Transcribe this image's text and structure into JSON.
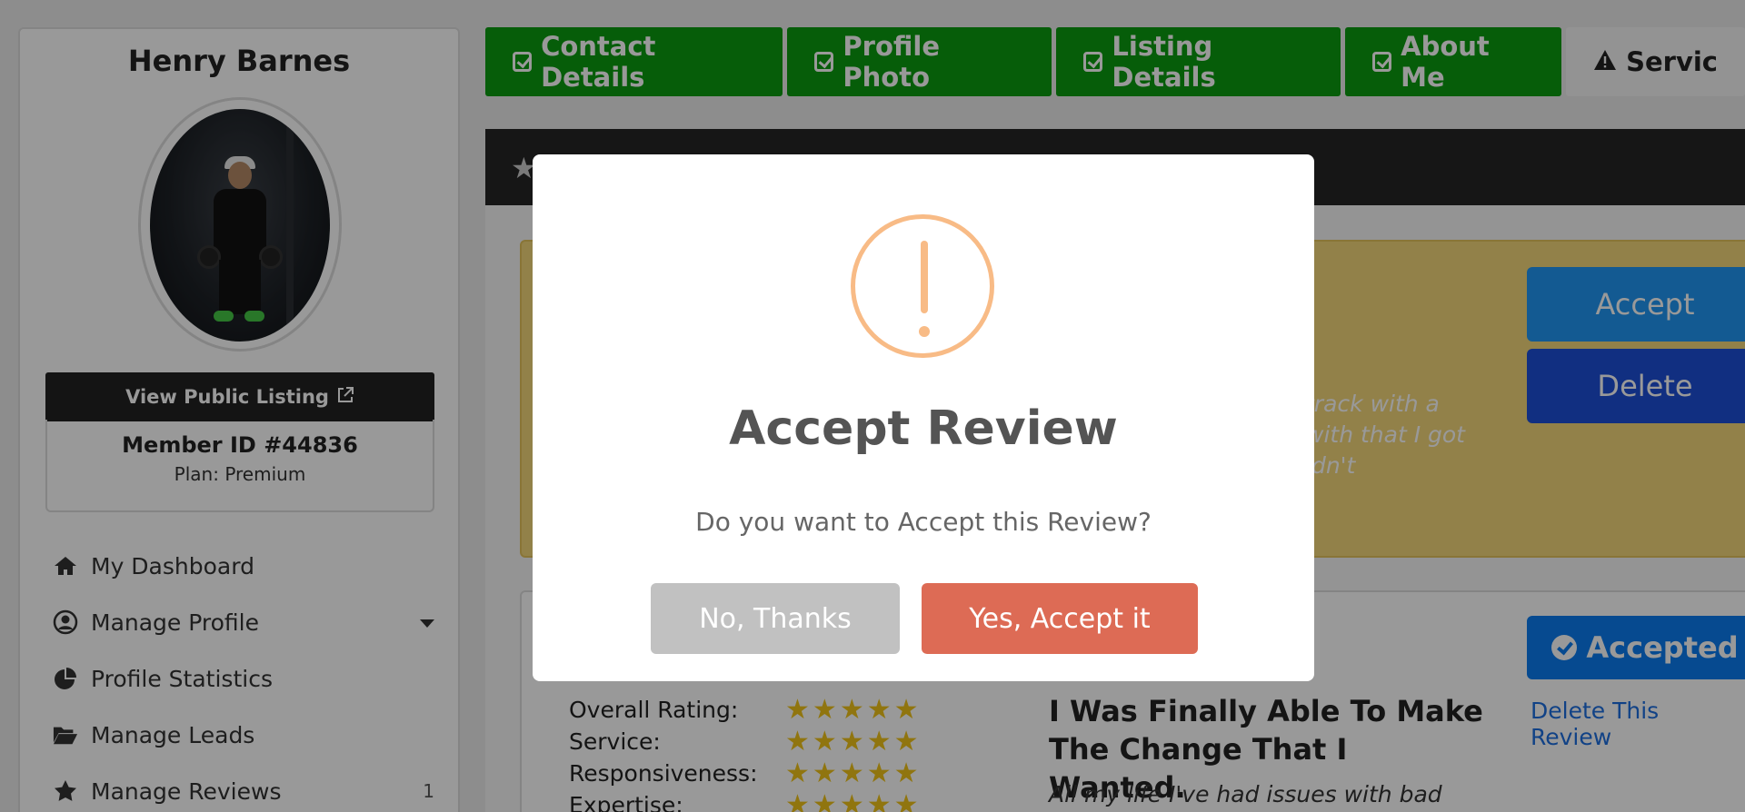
{
  "sidebar": {
    "user_name": "Henry Barnes",
    "view_public_listing": "View Public Listing",
    "member_id": "Member ID #44836",
    "plan": "Plan: Premium",
    "nav": [
      {
        "label": "My Dashboard",
        "icon": "home-icon"
      },
      {
        "label": "Manage Profile",
        "icon": "user-circle-icon"
      },
      {
        "label": "Profile Statistics",
        "icon": "pie-chart-icon"
      },
      {
        "label": "Manage Leads",
        "icon": "folder-open-icon"
      },
      {
        "label": "Manage Reviews",
        "icon": "star-icon",
        "count": "1"
      }
    ]
  },
  "tabs": [
    {
      "label": "Contact Details",
      "status": "complete"
    },
    {
      "label": "Profile Photo",
      "status": "complete"
    },
    {
      "label": "Listing Details",
      "status": "complete"
    },
    {
      "label": "About Me",
      "status": "complete"
    },
    {
      "label": "Servic",
      "status": "warning"
    }
  ],
  "pending_review": {
    "snippet": "track with a with that I got ldn't",
    "accept_label": "Accept",
    "delete_label": "Delete"
  },
  "accepted_review": {
    "status_label": "Accepted",
    "delete_link": "Delete This Review",
    "ratings": [
      {
        "label": "Overall Rating:",
        "stars": 5
      },
      {
        "label": "Service:",
        "stars": 5
      },
      {
        "label": "Responsiveness:",
        "stars": 5
      },
      {
        "label": "Expertise:",
        "stars": 5
      }
    ],
    "title": "I Was Finally Able To Make The Change That I Wanted.",
    "snippet": "All my life I've had issues with bad"
  },
  "modal": {
    "title": "Accept Review",
    "text": "Do you want to Accept this Review?",
    "cancel_label": "No, Thanks",
    "confirm_label": "Yes, Accept it"
  },
  "colors": {
    "tab_complete": "#0a9b10",
    "confirm_button": "#dd6b55",
    "cancel_button": "#c1c1c1",
    "warning_icon": "#f8bb86",
    "accept_button": "#2196f3",
    "accepted_badge": "#0b7cf0"
  }
}
